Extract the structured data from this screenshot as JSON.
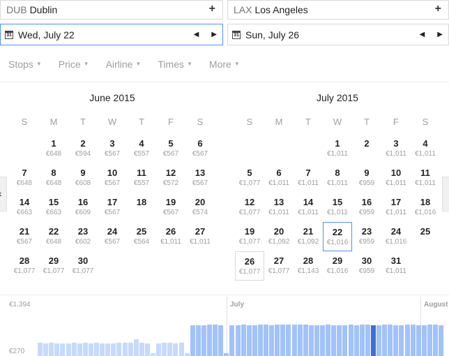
{
  "origin": {
    "code": "DUB",
    "city": "Dublin",
    "add": "+"
  },
  "destination": {
    "code": "LAX",
    "city": "Los Angeles",
    "add": "+"
  },
  "depart_date": "Wed, July 22",
  "return_date": "Sun, July 26",
  "cal_icon_text": "31",
  "filters": [
    "Stops",
    "Price",
    "Airline",
    "Times",
    "More"
  ],
  "weekdays": [
    "S",
    "M",
    "T",
    "W",
    "T",
    "F",
    "S"
  ],
  "calendars": [
    {
      "title": "June 2015",
      "start_offset": 1,
      "days": [
        {
          "d": "1",
          "p": "€648"
        },
        {
          "d": "2",
          "p": "€594"
        },
        {
          "d": "3",
          "p": "€567"
        },
        {
          "d": "4",
          "p": "€557"
        },
        {
          "d": "5",
          "p": "€567"
        },
        {
          "d": "6",
          "p": "€567"
        },
        {
          "d": "7",
          "p": "€648"
        },
        {
          "d": "8",
          "p": "€648"
        },
        {
          "d": "9",
          "p": "€608"
        },
        {
          "d": "10",
          "p": "€567"
        },
        {
          "d": "11",
          "p": "€557"
        },
        {
          "d": "12",
          "p": "€572"
        },
        {
          "d": "13",
          "p": "€567"
        },
        {
          "d": "14",
          "p": "€663"
        },
        {
          "d": "15",
          "p": "€663"
        },
        {
          "d": "16",
          "p": "€609"
        },
        {
          "d": "17",
          "p": "€567"
        },
        {
          "d": "18",
          "p": ""
        },
        {
          "d": "19",
          "p": "€567"
        },
        {
          "d": "20",
          "p": "€574"
        },
        {
          "d": "21",
          "p": "€567"
        },
        {
          "d": "22",
          "p": "€648"
        },
        {
          "d": "23",
          "p": "€602"
        },
        {
          "d": "24",
          "p": "€567"
        },
        {
          "d": "25",
          "p": "€564"
        },
        {
          "d": "26",
          "p": "€1,011"
        },
        {
          "d": "27",
          "p": "€1,011"
        },
        {
          "d": "28",
          "p": "€1,077"
        },
        {
          "d": "29",
          "p": "€1,077"
        },
        {
          "d": "30",
          "p": "€1,077"
        }
      ]
    },
    {
      "title": "July 2015",
      "start_offset": 3,
      "days": [
        {
          "d": "1",
          "p": "€1,011"
        },
        {
          "d": "2",
          "p": ""
        },
        {
          "d": "3",
          "p": "€1,011"
        },
        {
          "d": "4",
          "p": "€1,011"
        },
        {
          "d": "5",
          "p": "€1,077"
        },
        {
          "d": "6",
          "p": "€1,011"
        },
        {
          "d": "7",
          "p": "€1,011"
        },
        {
          "d": "8",
          "p": "€1,011"
        },
        {
          "d": "9",
          "p": "€959"
        },
        {
          "d": "10",
          "p": "€1,011"
        },
        {
          "d": "11",
          "p": "€1,011"
        },
        {
          "d": "12",
          "p": "€1,077"
        },
        {
          "d": "13",
          "p": "€1,011"
        },
        {
          "d": "14",
          "p": "€1,011"
        },
        {
          "d": "15",
          "p": "€1,011"
        },
        {
          "d": "16",
          "p": "€959"
        },
        {
          "d": "17",
          "p": "€1,011"
        },
        {
          "d": "18",
          "p": "€1,016"
        },
        {
          "d": "19",
          "p": "€1,077"
        },
        {
          "d": "20",
          "p": "€1,092"
        },
        {
          "d": "21",
          "p": "€1,092"
        },
        {
          "d": "22",
          "p": "€1,016"
        },
        {
          "d": "23",
          "p": "€959"
        },
        {
          "d": "24",
          "p": "€1,016"
        },
        {
          "d": "25",
          "p": ""
        },
        {
          "d": "26",
          "p": "€1,077"
        },
        {
          "d": "27",
          "p": "€1,077"
        },
        {
          "d": "28",
          "p": "€1,143"
        },
        {
          "d": "29",
          "p": "€1,016"
        },
        {
          "d": "30",
          "p": "€959"
        },
        {
          "d": "31",
          "p": "€1,011"
        }
      ]
    }
  ],
  "selected": {
    "depart": "22",
    "return": "26"
  },
  "chart_data": {
    "type": "bar",
    "ymax_label": "€1,394",
    "ymin_label": "€270",
    "ylim": [
      270,
      1394
    ],
    "month_labels": [
      "July",
      "August"
    ],
    "values": [
      567,
      557,
      567,
      557,
      557,
      557,
      567,
      557,
      567,
      557,
      572,
      557,
      557,
      557,
      567,
      567,
      567,
      663,
      567,
      557,
      270,
      557,
      567,
      567,
      557,
      567,
      270,
      1077,
      1077,
      1077,
      1092,
      1092,
      1077,
      270,
      1077,
      1077,
      1092,
      1077,
      1077,
      1092,
      1092,
      1077,
      1092,
      1092,
      1092,
      1092,
      1092,
      1092,
      1077,
      1077,
      1077,
      1092,
      1077,
      1077,
      1077,
      1092,
      1077,
      1092,
      1092,
      1077,
      1077,
      1092,
      1092,
      1077,
      1077,
      1092,
      1092,
      1077,
      1077,
      1092,
      1092,
      1077
    ],
    "highlight_range": [
      27,
      71
    ],
    "selected_index": 59,
    "colors": {
      "bar": "#c6dafc",
      "bar_highlight": "#a1c2fa",
      "bar_selected": "#3b6fd6",
      "accent": "#4d90fe"
    }
  }
}
